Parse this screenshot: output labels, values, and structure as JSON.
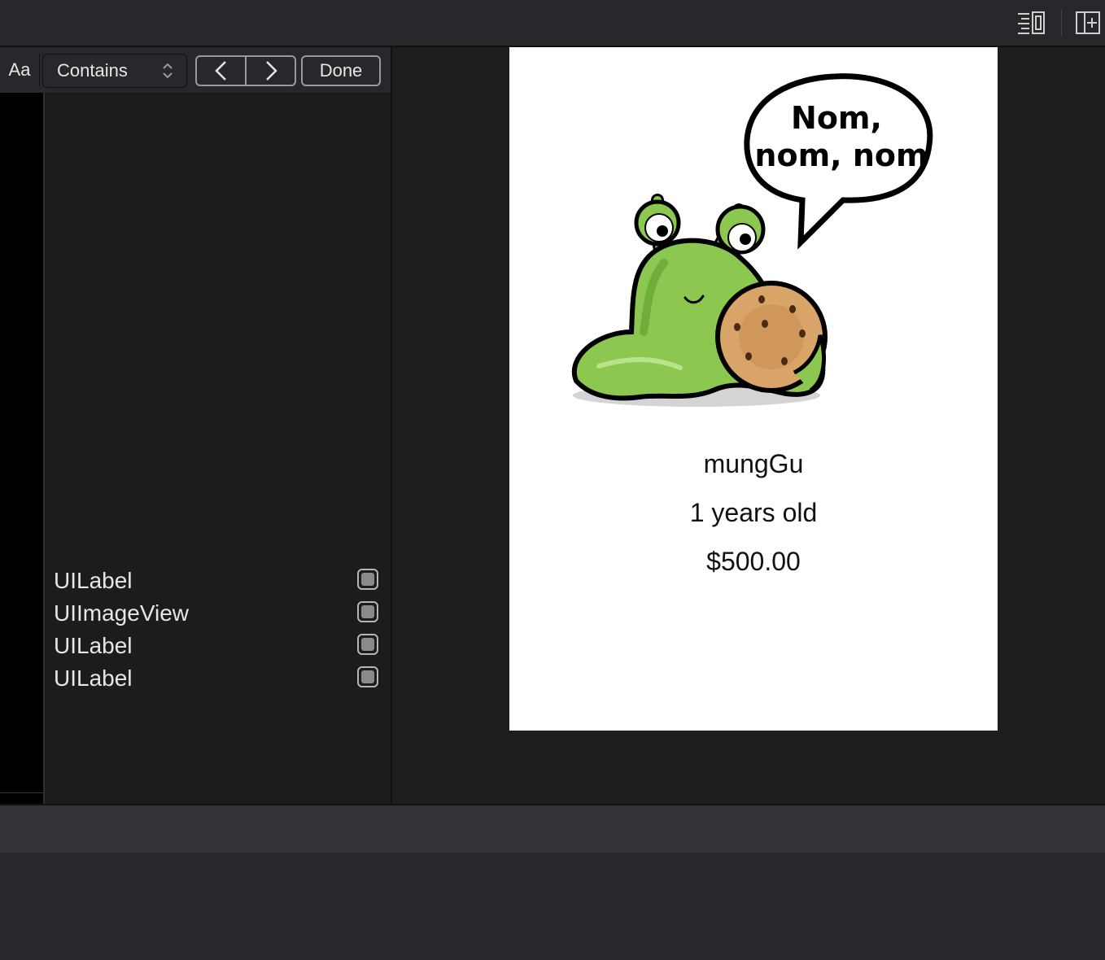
{
  "find_bar": {
    "match_case_label": "Aa",
    "match_mode": "Contains",
    "done_label": "Done"
  },
  "outline": {
    "items": [
      {
        "label": "UILabel"
      },
      {
        "label": "UIImageView"
      },
      {
        "label": "UILabel"
      },
      {
        "label": "UILabel"
      }
    ]
  },
  "preview": {
    "speech_line1": "Nom,",
    "speech_line2": "nom, nom",
    "name": "mungGu",
    "age": "1 years old",
    "price": "$500.00"
  },
  "colors": {
    "background": "#1c1c1e",
    "toolbar": "#27282c",
    "device_background": "#ffffff",
    "snail_green": "#8cc850",
    "cookie": "#d9a468"
  },
  "icons": [
    "minimap-icon",
    "add-editor-icon",
    "chevron-up-down-icon",
    "chevron-left-icon",
    "chevron-right-icon"
  ]
}
